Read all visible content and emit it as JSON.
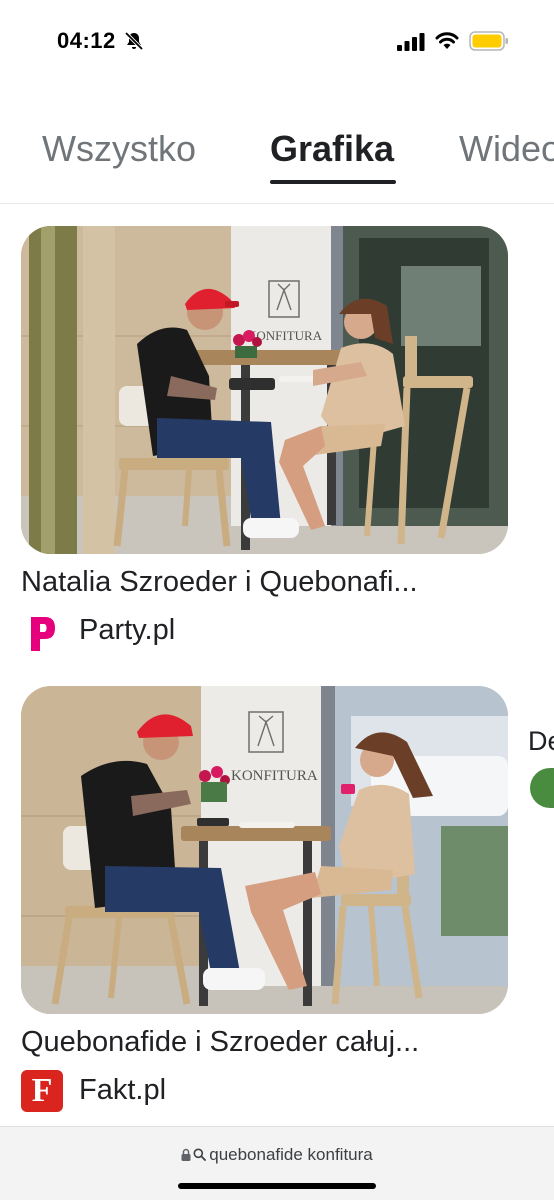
{
  "status_bar": {
    "time": "04:12"
  },
  "tabs": [
    {
      "label": "Wszystko"
    },
    {
      "label": "Grafika",
      "selected": true
    },
    {
      "label": "Wideo"
    }
  ],
  "results": [
    {
      "title": "Natalia Szroeder i Quebonafi...",
      "source": "Party.pl",
      "logo_letter": "p",
      "logo_color": "#e6007e",
      "sign_text": "KONFITURA"
    },
    {
      "title": "Quebonafide i Szroeder całuj...",
      "source": "Fakt.pl",
      "logo_letter": "F",
      "logo_color": "#d9251d",
      "sign_text": "KONFITURA"
    }
  ],
  "peek": {
    "label": "De"
  },
  "address_bar": {
    "query": "quebonafide konfitura"
  },
  "colors": {
    "accent": "#202124",
    "muted": "#70757a",
    "battery": "#ffcc00"
  }
}
